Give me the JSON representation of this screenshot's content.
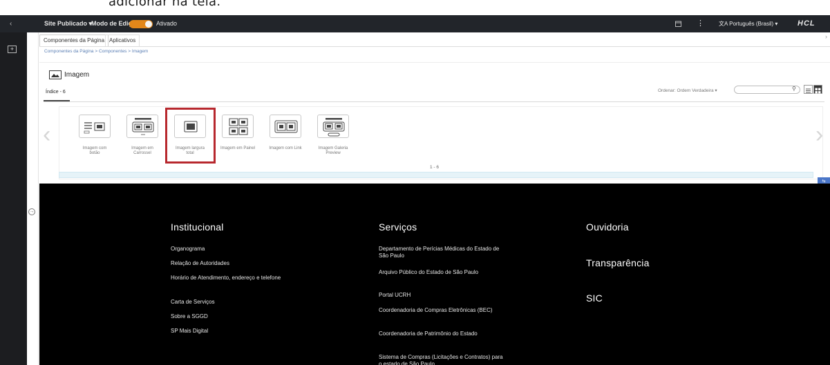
{
  "caption": "adicionar na tela.",
  "topbar": {
    "site": "Site Publicado",
    "site_caret": "▾",
    "mode_label": "Modo de Edição:",
    "mode_state": "Ativado",
    "language": "Português (Brasil)",
    "language_caret": "▾",
    "brand": "HCL",
    "accent_color": "#e3871a"
  },
  "tabs": [
    "Componentes da Página",
    "Aplicativos"
  ],
  "breadcrumb": "Componentes da Página  >  Componentes  >  Imagem",
  "section_title": "Imagem",
  "index_tab": "Índice - 6",
  "order_label": "Ordenar: Ordem Verdadeira",
  "order_caret": "▾",
  "cards": [
    {
      "label": [
        "Imagem com",
        "botão"
      ],
      "icon": "image-with-button-icon"
    },
    {
      "label": [
        "Imagem em",
        "Carrossel"
      ],
      "icon": "image-carousel-icon"
    },
    {
      "label": [
        "Imagem largura",
        "total"
      ],
      "icon": "full-width-image-icon"
    },
    {
      "label": [
        "Imagem em Painel"
      ],
      "icon": "image-panel-icon"
    },
    {
      "label": [
        "Imagem com Link"
      ],
      "icon": "image-link-icon"
    },
    {
      "label": [
        "Imagem Galeria",
        "Preview"
      ],
      "icon": "image-gallery-icon"
    }
  ],
  "pagination": "1 - 6",
  "footer": {
    "institucional": {
      "title": "Institucional",
      "links": [
        "Organograma",
        "Relação de Autoridades",
        "Horário de Atendimento, endereço e telefone",
        "Carta de Serviços",
        "Sobre a SGGD",
        "SP Mais Digital"
      ]
    },
    "servicos": {
      "title": "Serviços",
      "links": [
        "Departamento de Perícias Médicas do Estado de São Paulo",
        "Arquivo Público do Estado de São Paulo",
        "Portal UCRH",
        "Coordenadoria de Compras Eletrônicas (BEC)",
        "Coordenadoria de Patrimônio do Estado",
        "Sistema de Compras (Licitações e Contratos) para o estado de São Paulo"
      ]
    },
    "col3": [
      "Ouvidoria",
      "Transparência",
      "SIC"
    ]
  },
  "highlight_color": "#b7282e"
}
